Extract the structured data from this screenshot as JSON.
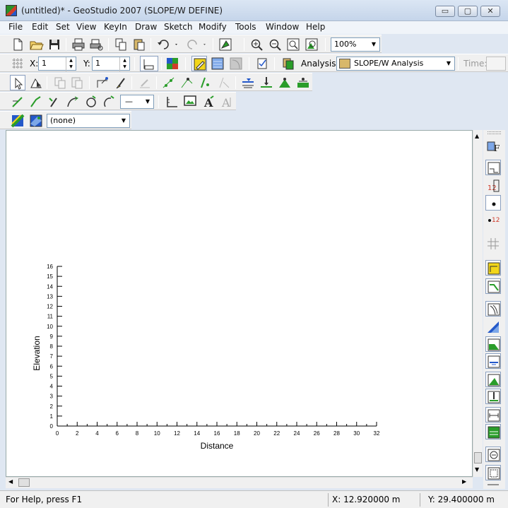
{
  "window": {
    "title": "(untitled)* - GeoStudio 2007 (SLOPE/W DEFINE)",
    "min_glyph": "▭",
    "max_glyph": "▢",
    "close_glyph": "✕"
  },
  "menu": [
    "File",
    "Edit",
    "Set",
    "View",
    "KeyIn",
    "Draw",
    "Sketch",
    "Modify",
    "Tools",
    "Window",
    "Help"
  ],
  "toolbar": {
    "zoom": "100%",
    "x_label": "X:",
    "x_value": "1",
    "y_label": "Y:",
    "y_value": "1",
    "analysis_label": "Analysis:",
    "analysis_value": "SLOPE/W Analysis",
    "time_label": "Time:",
    "line_style_value": "—",
    "regions_value": "(none)"
  },
  "chart_data": {
    "type": "scatter",
    "xlabel": "Distance",
    "ylabel": "Elevation",
    "xlim": [
      0,
      32
    ],
    "ylim": [
      0,
      16
    ],
    "x_ticks": [
      0,
      2,
      4,
      6,
      8,
      10,
      12,
      14,
      16,
      18,
      20,
      22,
      24,
      26,
      28,
      30,
      32
    ],
    "y_ticks": [
      0,
      1,
      2,
      3,
      4,
      5,
      6,
      7,
      8,
      9,
      10,
      11,
      12,
      13,
      14,
      15,
      16
    ],
    "series": []
  },
  "status": {
    "help": "For Help, press F1",
    "x": "X: 12.920000 m",
    "y": "Y: 29.400000 m"
  },
  "colors": {
    "accent_blue": "#2458c9",
    "accent_green": "#2a9d2a",
    "accent_yellow": "#f2d61a"
  }
}
